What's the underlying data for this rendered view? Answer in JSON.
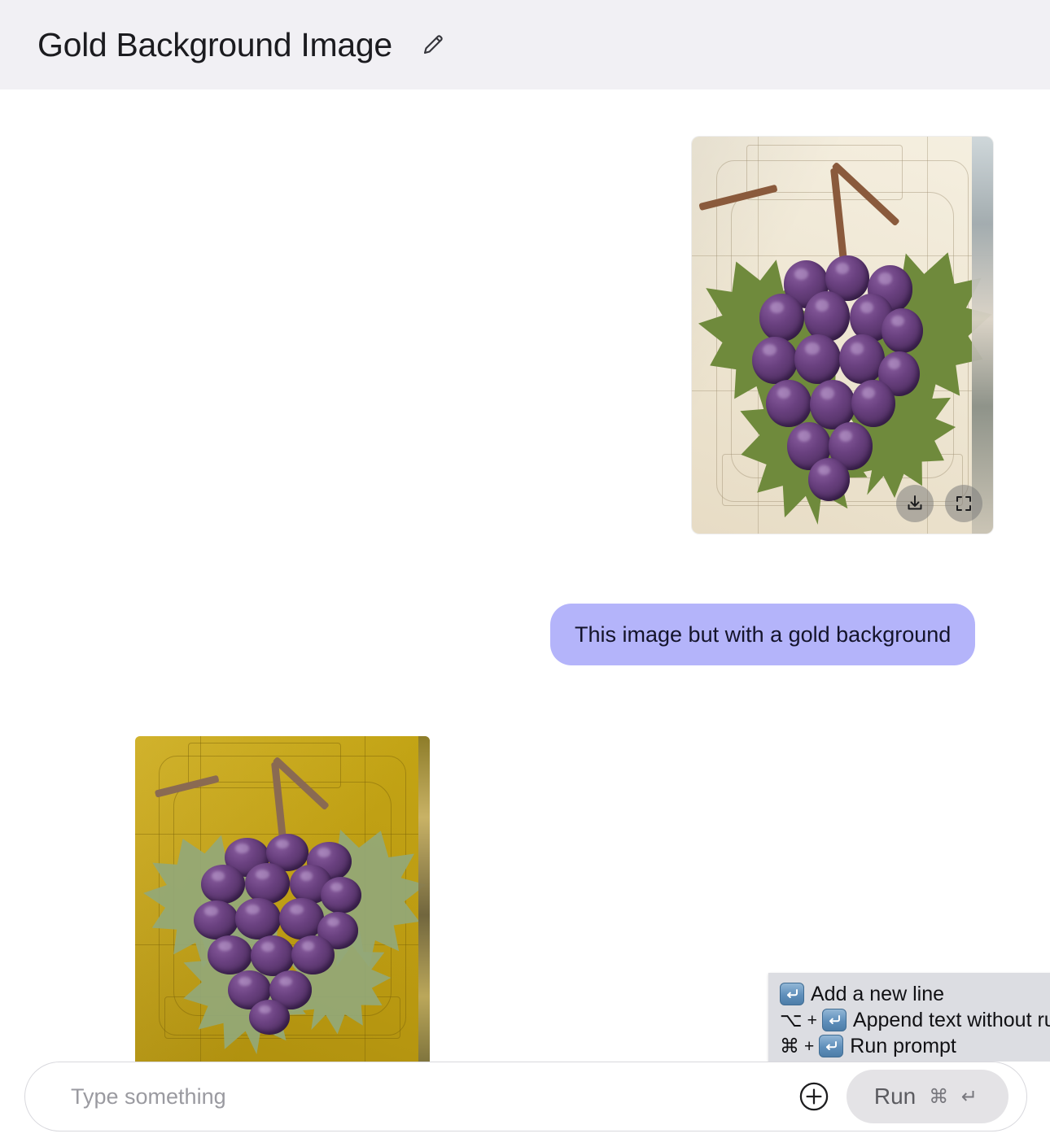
{
  "header": {
    "title": "Gold Background Image",
    "edit_icon": "pencil-icon"
  },
  "conversation": {
    "original_image": {
      "alt": "Painted purple grape cluster with green leaves on cream embossed cardboard",
      "actions": [
        {
          "name": "download-icon",
          "label": "Download"
        },
        {
          "name": "fullscreen-icon",
          "label": "Expand"
        }
      ]
    },
    "user_message": {
      "text": "This image but with a gold background"
    },
    "result_image": {
      "alt": "Same grape cluster painting recolored with a gold background"
    }
  },
  "shortcut_tooltip": {
    "rows": [
      {
        "modifier": "",
        "key_icon": "return-key-icon",
        "label": "Add a new line"
      },
      {
        "modifier": "⌥",
        "key_icon": "return-key-icon",
        "label": "Append text without run"
      },
      {
        "modifier": "⌘",
        "key_icon": "return-key-icon",
        "label": "Run prompt"
      }
    ]
  },
  "composer": {
    "placeholder": "Type something",
    "value": "",
    "add_icon": "plus-circle-icon",
    "run_label": "Run",
    "run_shortcut": "⌘ ↵"
  },
  "colors": {
    "header_background": "#f1f0f4",
    "user_bubble": "#b4b4fa",
    "gold_background": "#c8a513",
    "cream_background": "#efe7d4",
    "grape_purple": "#5c3a6b",
    "leaf_green": "#6f8a3c",
    "tooltip_background": "#dcdde2",
    "run_button": "#e4e3e6"
  }
}
